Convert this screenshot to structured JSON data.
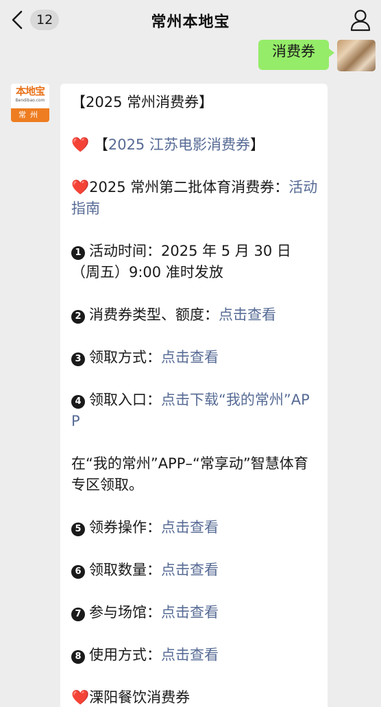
{
  "navbar": {
    "back_count": "12",
    "title": "常州本地宝"
  },
  "outgoing": {
    "message": "消费券"
  },
  "incoming_avatar": {
    "logo_text": "本地宝",
    "logo_url": "Bendibao.com",
    "city": "常州"
  },
  "message": {
    "heading": "【2025 常州消费券】",
    "item_movie": {
      "prefix": "【",
      "link": "2025 江苏电影消费券",
      "suffix": "】"
    },
    "item_sport": {
      "text": "2025 常州第二批体育消费券：",
      "link": "活动指南"
    },
    "steps": [
      {
        "num": "1",
        "text": "活动时间：2025 年 5 月 30 日（周五）9:00 准时发放",
        "link": ""
      },
      {
        "num": "2",
        "text": "消费券类型、额度：",
        "link": "点击查看"
      },
      {
        "num": "3",
        "text": "领取方式：",
        "link": "点击查看"
      },
      {
        "num": "4",
        "text": "领取入口：",
        "link": "点击下载“我的常州”APP"
      }
    ],
    "note": "在“我的常州”APP–“常享动”智慧体育专区领取。",
    "steps2": [
      {
        "num": "5",
        "text": "领券操作：",
        "link": "点击查看"
      },
      {
        "num": "6",
        "text": "领取数量：",
        "link": "点击查看"
      },
      {
        "num": "7",
        "text": "参与场馆：",
        "link": "点击查看"
      },
      {
        "num": "8",
        "text": "使用方式：",
        "link": "点击查看"
      }
    ],
    "item_dining": "溧阳餐饮消费券"
  },
  "colors": {
    "background": "#ededed",
    "outgoing_bubble": "#95ec69",
    "link": "#576b95",
    "heart": "#e8364a",
    "logo_orange": "#ee7d21"
  },
  "icons": {
    "back": "chevron-left-icon",
    "profile": "person-icon",
    "heart": "heart-icon"
  }
}
